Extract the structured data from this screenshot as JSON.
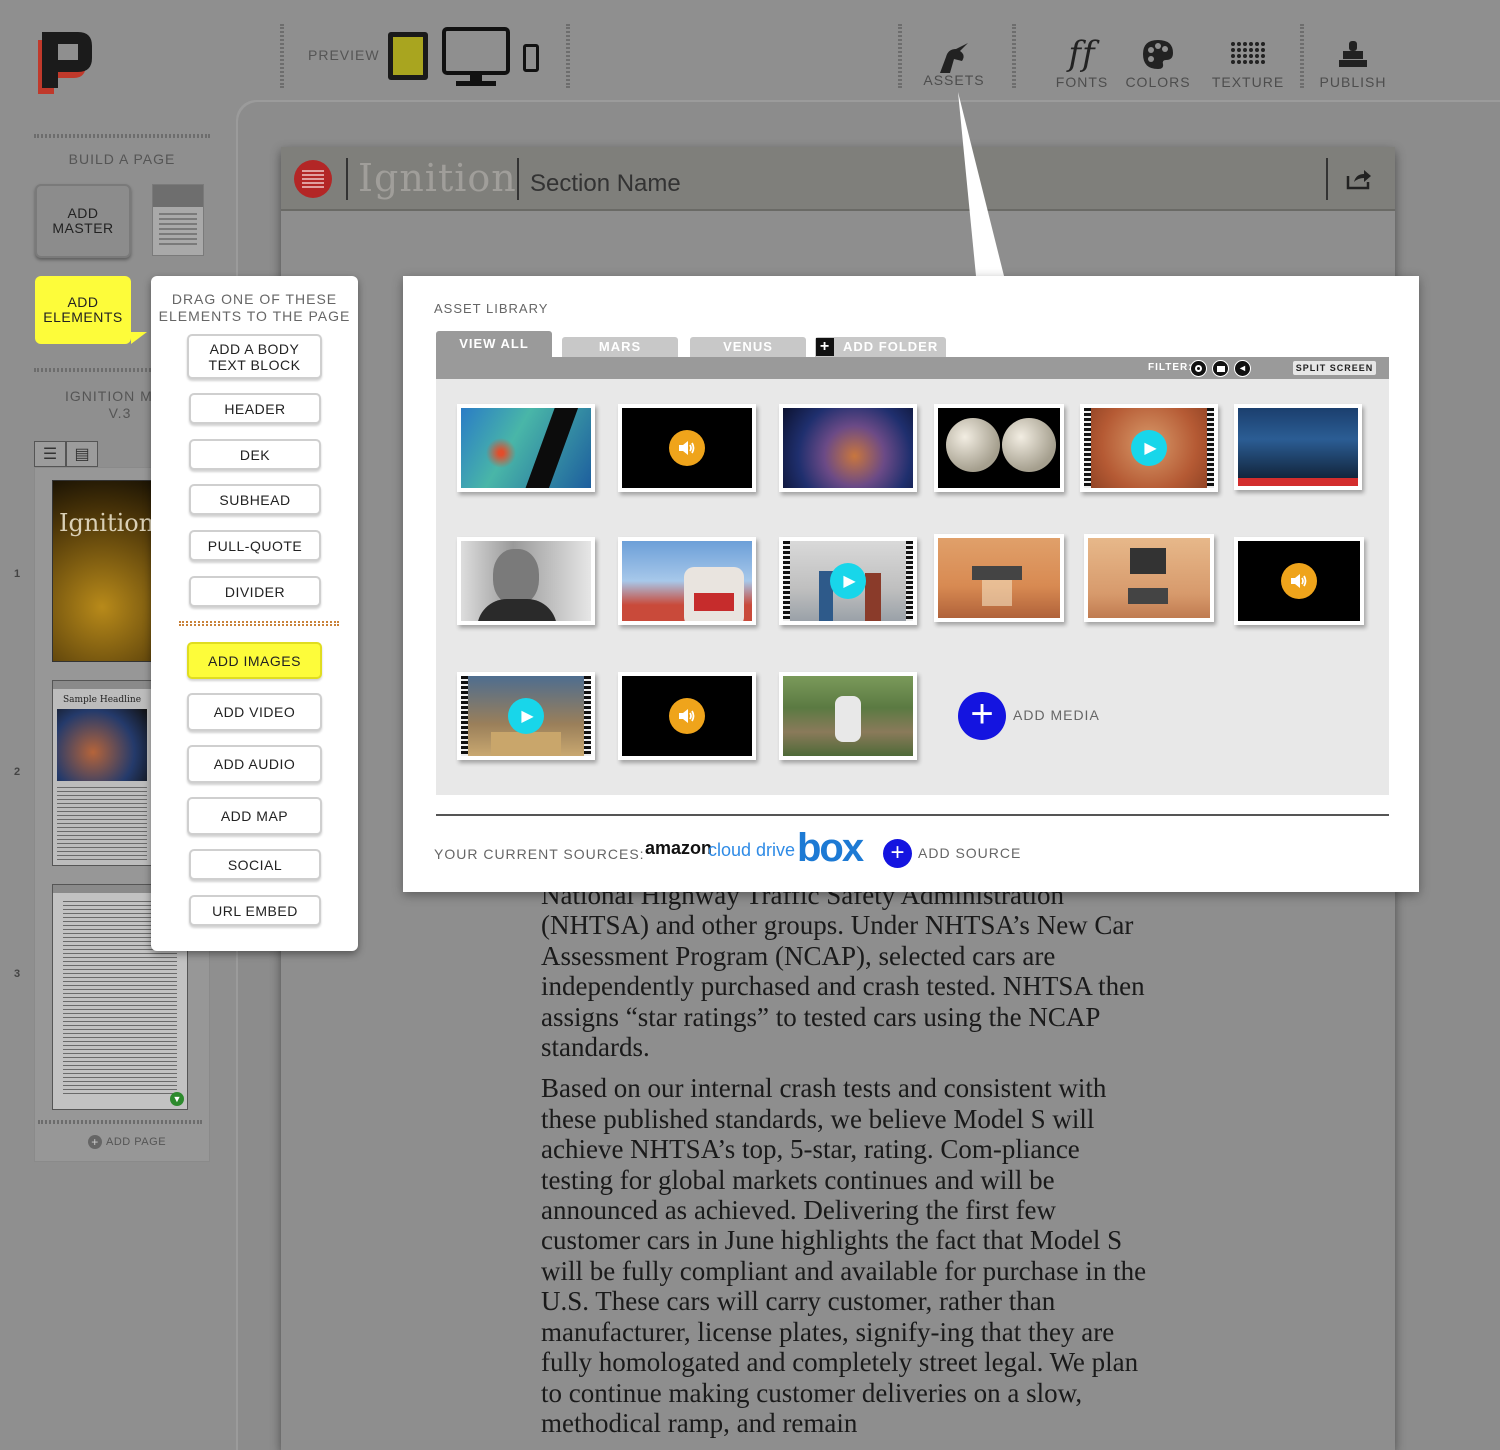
{
  "toolbar": {
    "preview_label": "PREVIEW",
    "tools": [
      {
        "label": "ASSETS",
        "icon": "unicorn-icon"
      },
      {
        "label": "FONTS",
        "icon": "fonts-icon"
      },
      {
        "label": "COLORS",
        "icon": "palette-icon"
      },
      {
        "label": "TEXTURE",
        "icon": "texture-icon"
      },
      {
        "label": "PUBLISH",
        "icon": "stamp-icon"
      }
    ]
  },
  "sidebar": {
    "build_title": "BUILD A PAGE",
    "add_master": "ADD\nMASTER",
    "add_elements": "ADD\nELEMENTS",
    "mag_title": "IGNITION MAG\nV.3",
    "page_numbers": [
      "1",
      "2",
      "3"
    ],
    "thumb1_title": "Ignition",
    "thumb2_headline": "Sample Headline",
    "add_page": "ADD PAGE"
  },
  "document": {
    "brand": "Ignition",
    "section_name": "Section Name",
    "paragraphs": [
      "National Highway Traffic Safety Administration (NHTSA) and other groups. Under NHTSA’s New Car Assessment Program (NCAP), selected cars are independently purchased and crash tested. NHTSA then assigns “star ratings” to tested cars using the NCAP standards.",
      "Based on our internal crash tests and consistent with these published standards, we believe Model S will achieve NHTSA’s top, 5-star, rating. Com-pliance testing for global markets continues and will be announced as achieved. Delivering the first few customer cars in June highlights the fact that Model S will be fully compliant and available for purchase in the U.S. These cars will carry customer, rather than manufacturer, license plates, signify-ing that they are fully homologated and completely street legal. We plan to continue making customer deliveries on a slow, methodical ramp, and remain"
    ]
  },
  "elements_popover": {
    "title": "DRAG ONE OF THESE\nELEMENTS TO THE PAGE",
    "buttons": [
      "ADD A BODY\nTEXT BLOCK",
      "HEADER",
      "DEK",
      "SUBHEAD",
      "PULL-QUOTE",
      "DIVIDER",
      "ADD IMAGES",
      "ADD VIDEO",
      "ADD AUDIO",
      "ADD MAP",
      "SOCIAL",
      "URL EMBED"
    ],
    "active": "ADD IMAGES"
  },
  "asset_library": {
    "title": "ASSET LIBRARY",
    "tabs": [
      "VIEW ALL",
      "MARS",
      "VENUS",
      "ADD FOLDER"
    ],
    "active_tab": "VIEW ALL",
    "filter_label": "FILTER:",
    "split_screen": "SPLIT SCREEN",
    "add_media": "ADD MEDIA",
    "sources_label": "YOUR CURRENT SOURCES:",
    "source_amazon": "amazon",
    "source_cloud": "cloud drive",
    "source_box": "box",
    "add_source": "ADD SOURCE",
    "assets": [
      {
        "kind": "image",
        "subject": "satellite-map"
      },
      {
        "kind": "audio",
        "subject": "audio"
      },
      {
        "kind": "image",
        "subject": "nebula"
      },
      {
        "kind": "image",
        "subject": "two-planets"
      },
      {
        "kind": "video",
        "subject": "mars-surface"
      },
      {
        "kind": "image",
        "subject": "mission-control"
      },
      {
        "kind": "image",
        "subject": "portrait-bw"
      },
      {
        "kind": "image",
        "subject": "protest"
      },
      {
        "kind": "video",
        "subject": "lab-people"
      },
      {
        "kind": "image",
        "subject": "lander"
      },
      {
        "kind": "image",
        "subject": "sky-crane"
      },
      {
        "kind": "audio",
        "subject": "audio"
      },
      {
        "kind": "video",
        "subject": "man-with-box"
      },
      {
        "kind": "audio",
        "subject": "audio"
      },
      {
        "kind": "image",
        "subject": "outdoor-person"
      }
    ]
  },
  "colors": {
    "accent_yellow": "#fdfc3a",
    "play_cyan": "#18d6ea",
    "audio_orange": "#efa41b",
    "add_blue": "#1414e0"
  }
}
